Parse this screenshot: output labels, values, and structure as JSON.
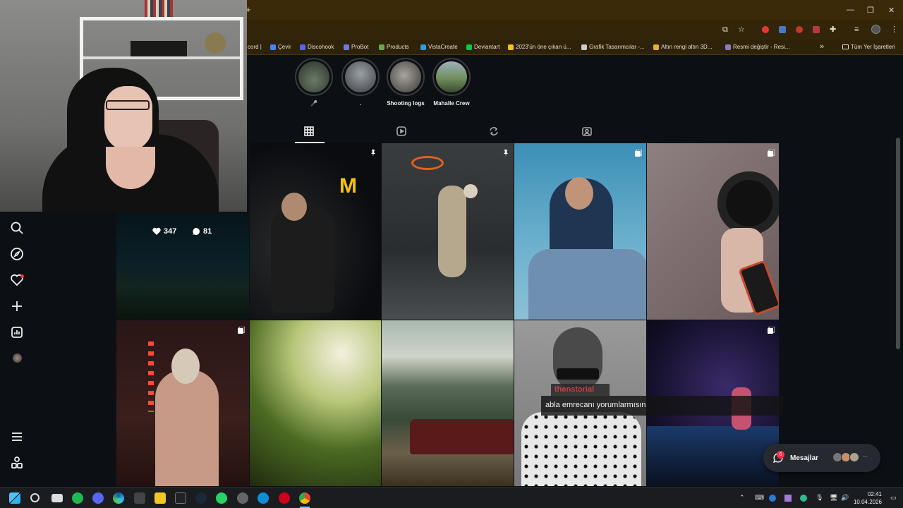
{
  "browser": {
    "new_tab": "+",
    "window_controls": [
      "—",
      "❐",
      "✕"
    ],
    "bookmarks": [
      {
        "label": "cord |",
        "color": "#5865f2"
      },
      {
        "label": "Çevir",
        "color": "#4285f4"
      },
      {
        "label": "Discohook",
        "color": "#5865f2"
      },
      {
        "label": "ProBot",
        "color": "#6c7ae0"
      },
      {
        "label": "Products",
        "color": "#6aa84f"
      },
      {
        "label": "VistaCreate",
        "color": "#2d9cdb"
      },
      {
        "label": "Deviantart",
        "color": "#05cc47"
      },
      {
        "label": "2023'ün öne çıkan ü...",
        "color": "#f5c518"
      },
      {
        "label": "Grafik Tasarımcılar -...",
        "color": "#cccccc"
      },
      {
        "label": "Altın rengi altın 3D...",
        "color": "#e6b422"
      },
      {
        "label": "Resmi değiştir - Resi...",
        "color": "#8e7cc3"
      }
    ],
    "bookmarks_overflow": "»",
    "all_bookmarks": "Tüm Yer İşaretleri"
  },
  "highlights": [
    {
      "label": "🎤",
      "color": "#3c4a3a"
    },
    {
      "label": ".",
      "color": "#555a60"
    },
    {
      "label": "Shooting logs",
      "color": "#7d7a78"
    },
    {
      "label": "Mahalle Crew",
      "color": "#4f6b4a"
    }
  ],
  "post_overlay": {
    "likes": "347",
    "comments": "81"
  },
  "caption": {
    "tag": "thenstorial",
    "text": "abla emrecanı yorumlarmısın"
  },
  "messages": {
    "label": "Mesajlar",
    "badge": "6",
    "more": "···"
  },
  "clock": {
    "time": "02:41",
    "date": "10.04.2026"
  },
  "colors": {
    "accent_red": "#ff3040",
    "page_bg": "#0c1014",
    "chrome_bg": "#3b2a0a"
  }
}
